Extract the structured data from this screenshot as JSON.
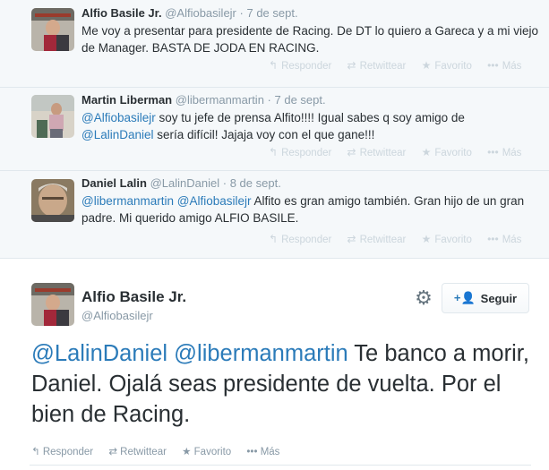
{
  "replies": [
    {
      "name": "Alfio Basile Jr.",
      "handle": "@Alfiobasilejr",
      "time": "7 de sept.",
      "text_parts": [
        {
          "t": "Me voy a presentar para presidente de Racing. De DT lo quiero a Gareca y a mi viejo de Manager. BASTA DE JODA EN RACING.",
          "m": false
        }
      ],
      "avatar": "avatar-alfio"
    },
    {
      "name": "Martin Liberman",
      "handle": "@libermanmartin",
      "time": "7 de sept.",
      "text_parts": [
        {
          "t": "@Alfiobasilejr",
          "m": true
        },
        {
          "t": " soy tu jefe de prensa Alfito!!!! Igual sabes q soy amigo de ",
          "m": false
        },
        {
          "t": "@LalinDaniel",
          "m": true
        },
        {
          "t": " sería difícil! Jajaja voy con el que gane!!!",
          "m": false
        }
      ],
      "avatar": "avatar-martin"
    },
    {
      "name": "Daniel Lalin",
      "handle": "@LalinDaniel",
      "time": "8 de sept.",
      "text_parts": [
        {
          "t": "@libermanmartin",
          "m": true
        },
        {
          "t": " ",
          "m": false
        },
        {
          "t": "@Alfiobasilejr",
          "m": true
        },
        {
          "t": " Alfito es gran amigo también. Gran hijo de un gran padre. Mi querido amigo ALFIO BASILE.",
          "m": false
        }
      ],
      "avatar": "avatar-daniel"
    }
  ],
  "actions": {
    "reply": "Responder",
    "retweet": "Retwittear",
    "favorite": "Favorito",
    "more": "Más"
  },
  "main": {
    "name": "Alfio Basile Jr.",
    "handle": "@Alfiobasilejr",
    "follow_label": "Seguir",
    "text_parts": [
      {
        "t": "@LalinDaniel",
        "m": true
      },
      {
        "t": " ",
        "m": false
      },
      {
        "t": "@libermanmartin",
        "m": true
      },
      {
        "t": " Te banco a morir, Daniel. Ojalá seas presidente de vuelta. Por el bien de Racing.",
        "m": false
      }
    ]
  },
  "colors": {
    "link": "#2b7bb9",
    "thread_bg": "#f5f8fa",
    "muted": "#8899a6"
  }
}
